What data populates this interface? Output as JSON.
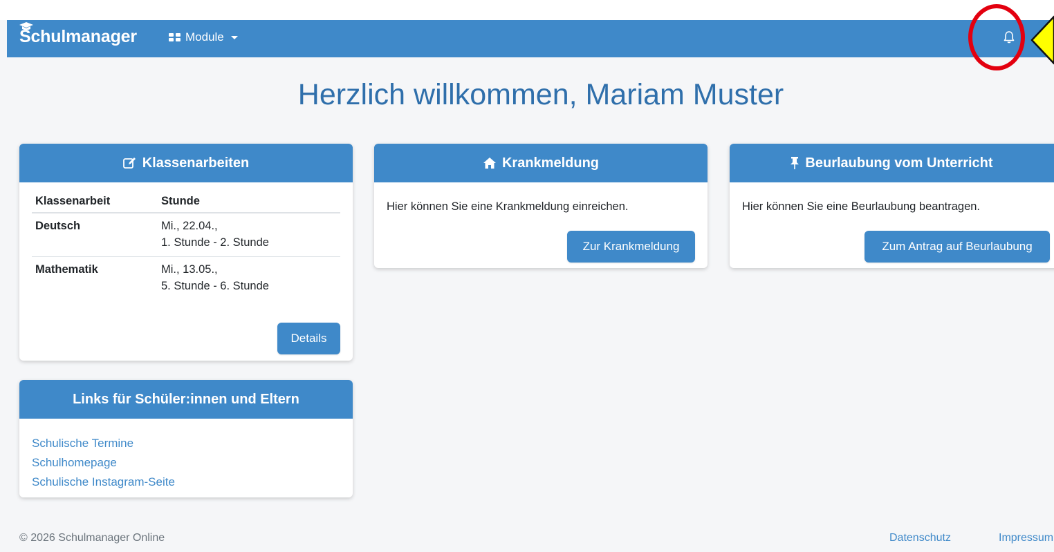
{
  "brand": {
    "name": "Schulmanager"
  },
  "nav": {
    "module_label": "Module"
  },
  "icons": {
    "grid": "grid-icon",
    "caret": "caret-down-icon",
    "bell": "bell-icon",
    "edit": "edit-icon",
    "home": "home-icon",
    "pin": "pin-icon"
  },
  "colors": {
    "accent": "#3f89c9",
    "heading": "#2f6fab",
    "annotation_circle": "#e3000f",
    "annotation_arrow": "#ffff00"
  },
  "welcome": {
    "text": "Herzlich willkommen, Mariam Muster"
  },
  "exams": {
    "title": "Klassenarbeiten",
    "col_exam": "Klassenarbeit",
    "col_period": "Stunde",
    "rows": [
      {
        "subject": "Deutsch",
        "date": "Mi., 22.04.,",
        "period": "1. Stunde - 2. Stunde"
      },
      {
        "subject": "Mathematik",
        "date": "Mi., 13.05.,",
        "period": "5. Stunde - 6. Stunde"
      }
    ],
    "button": "Details"
  },
  "sick": {
    "title": "Krankmeldung",
    "text": "Hier können Sie eine Krankmeldung einreichen.",
    "button": "Zur Krankmeldung"
  },
  "leave": {
    "title": "Beurlaubung vom Unterricht",
    "text": "Hier können Sie eine Beurlaubung beantragen.",
    "button": "Zum Antrag auf Beurlaubung"
  },
  "links": {
    "title": "Links für Schüler:innen und Eltern",
    "items": [
      "Schulische Termine",
      "Schulhomepage",
      "Schulische Instagram-Seite"
    ]
  },
  "footer": {
    "copyright": "© 2026 Schulmanager Online",
    "privacy": "Datenschutz",
    "imprint": "Impressum"
  }
}
